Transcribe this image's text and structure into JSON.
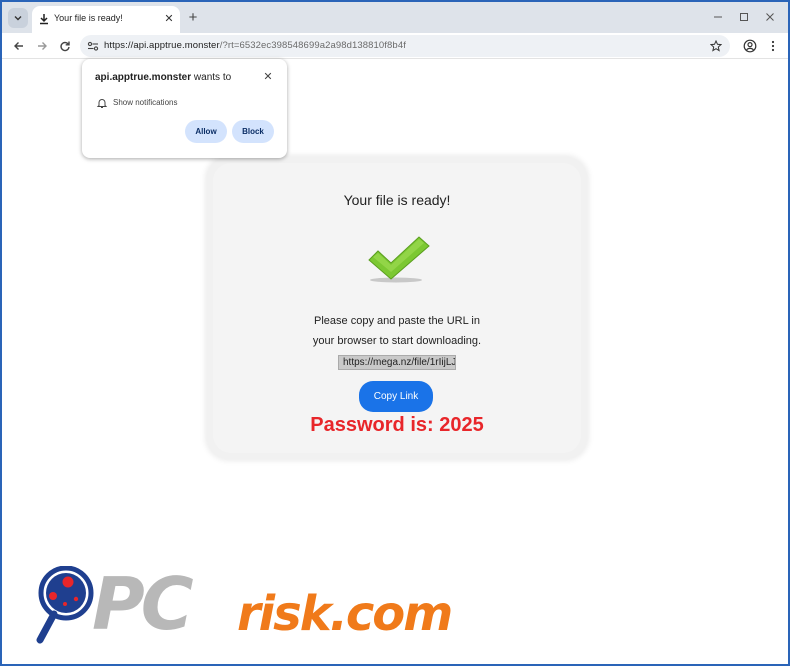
{
  "browser": {
    "tab": {
      "title": "Your file is ready!"
    },
    "url": {
      "host": "https://api.apptrue.monster",
      "path": "/?rt=6532ec398548699a2a98d138810f8b4f"
    }
  },
  "permission_prompt": {
    "site": "api.apptrue.monster",
    "wants_to": "wants to",
    "permission": "Show notifications",
    "allow_label": "Allow",
    "block_label": "Block"
  },
  "card": {
    "title": "Your file is ready!",
    "instruction_line1": "Please copy and paste the URL in",
    "instruction_line2": "your browser to start downloading.",
    "link_value": "https://mega.nz/file/1rIijLJ",
    "copy_button": "Copy Link",
    "password_text": "Password is: 2025"
  },
  "watermark": {
    "brand_pc": "PC",
    "brand_rest": "risk.com"
  },
  "colors": {
    "accent": "#1a73e8",
    "password": "#e8262a",
    "check": "#7cc832",
    "watermark_orange": "#f07a1a"
  },
  "icons": [
    "tab-list-icon",
    "download-icon",
    "close-icon",
    "new-tab-icon",
    "minimize-icon",
    "maximize-icon",
    "back-icon",
    "forward-icon",
    "reload-icon",
    "site-info-icon",
    "bookmark-star-icon",
    "profile-icon",
    "menu-icon",
    "bell-icon",
    "checkmark-icon"
  ]
}
